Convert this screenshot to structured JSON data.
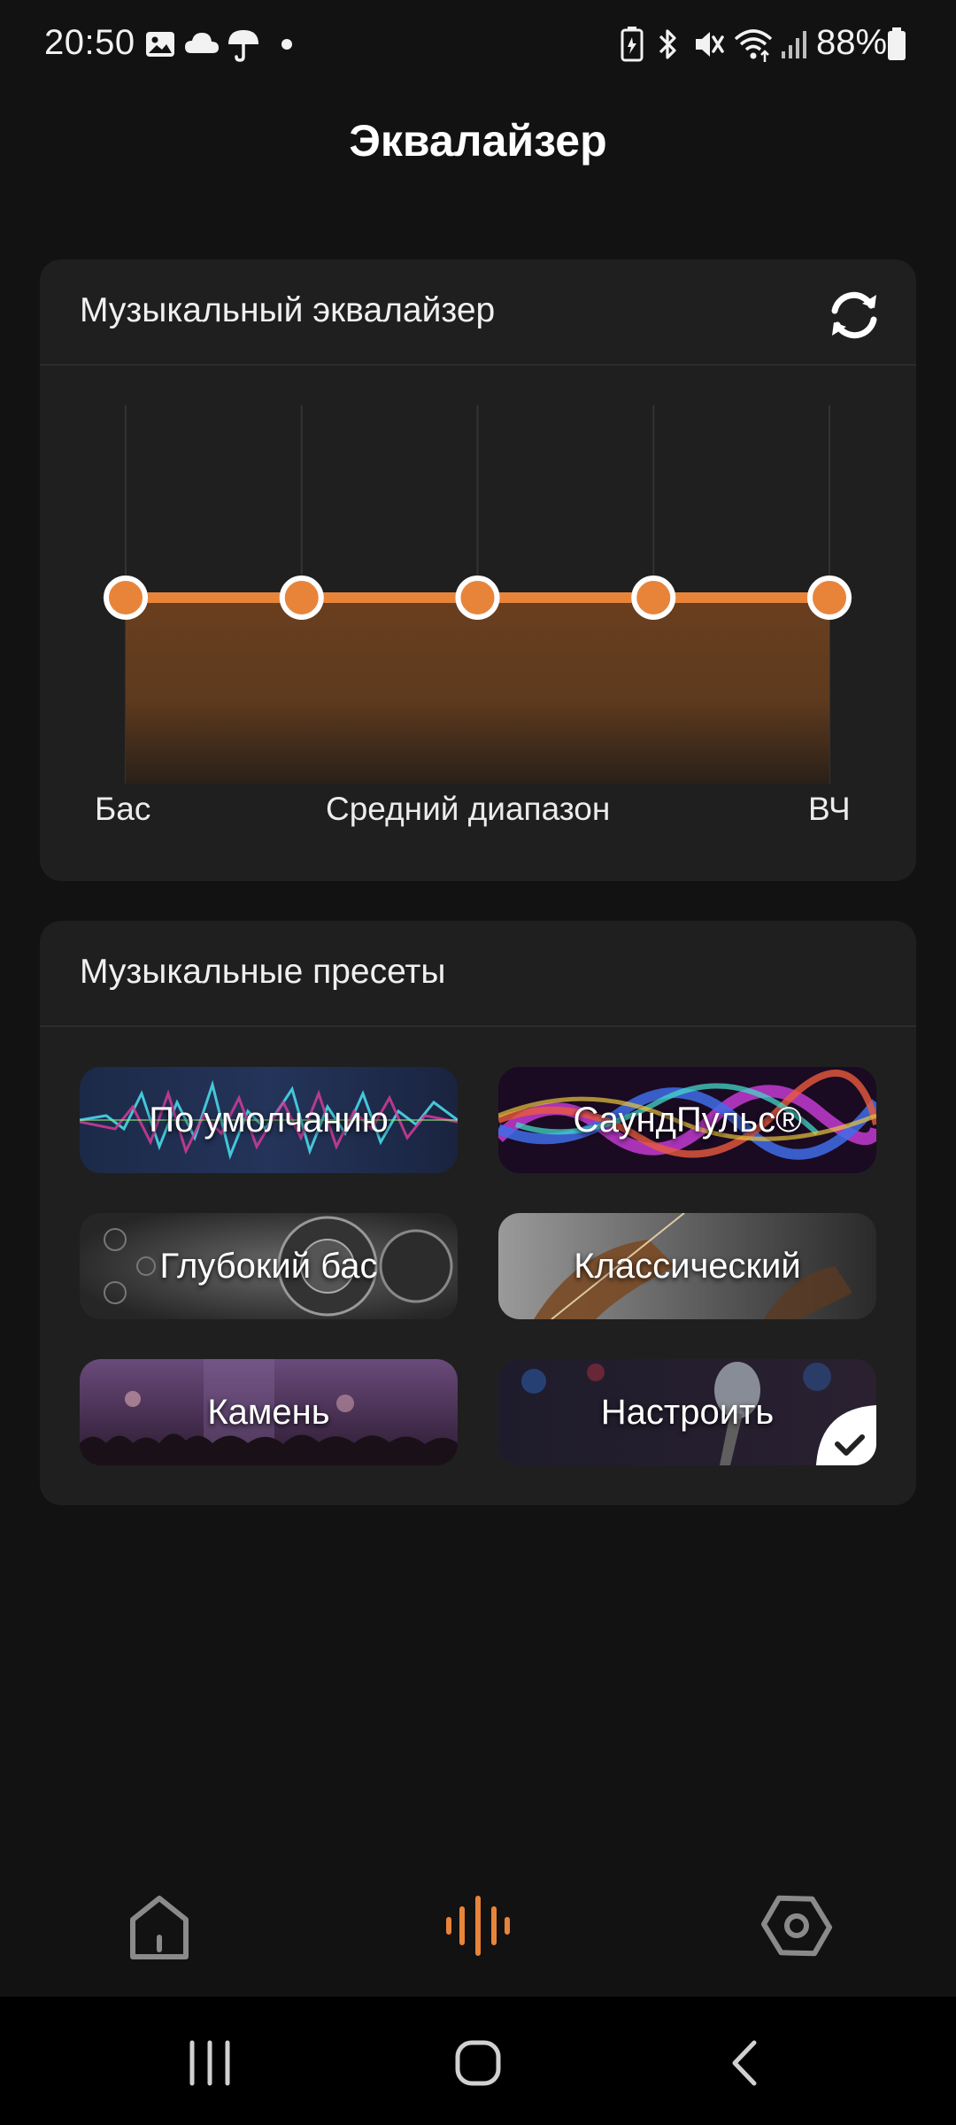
{
  "status_bar": {
    "time": "20:50",
    "battery_percent": "88%",
    "icons": [
      "image-icon",
      "cloud-icon",
      "umbrella-icon",
      "dot-icon",
      "battery-saver-icon",
      "bluetooth-icon",
      "mute-icon",
      "wifi-icon",
      "signal-icon",
      "battery-icon"
    ]
  },
  "page_title": "Эквалайзер",
  "equalizer": {
    "title": "Музыкальный эквалайзер",
    "refresh_icon": "refresh-icon",
    "accent_color": "#e8843a",
    "band_levels": [
      0,
      0,
      0,
      0,
      0
    ],
    "labels": {
      "bass": "Бас",
      "mid": "Средний диапазон",
      "treble": "ВЧ"
    }
  },
  "presets": {
    "title": "Музыкальные пресеты",
    "items": [
      {
        "label": "По умолчанию",
        "selected": false
      },
      {
        "label": "СаундПульс®",
        "selected": false
      },
      {
        "label": "Глубокий бас",
        "selected": false
      },
      {
        "label": "Классический",
        "selected": false
      },
      {
        "label": "Камень",
        "selected": false
      },
      {
        "label": "Настроить",
        "selected": true
      }
    ]
  },
  "bottom_nav": {
    "items": [
      {
        "icon": "home-icon",
        "active": false
      },
      {
        "icon": "equalizer-icon",
        "active": true
      },
      {
        "icon": "settings-icon",
        "active": false
      }
    ],
    "active_color": "#e8843a",
    "inactive_color": "#8a8a8a"
  },
  "system_nav": {
    "items": [
      "recent-apps-icon",
      "home-circle-icon",
      "back-icon"
    ]
  }
}
